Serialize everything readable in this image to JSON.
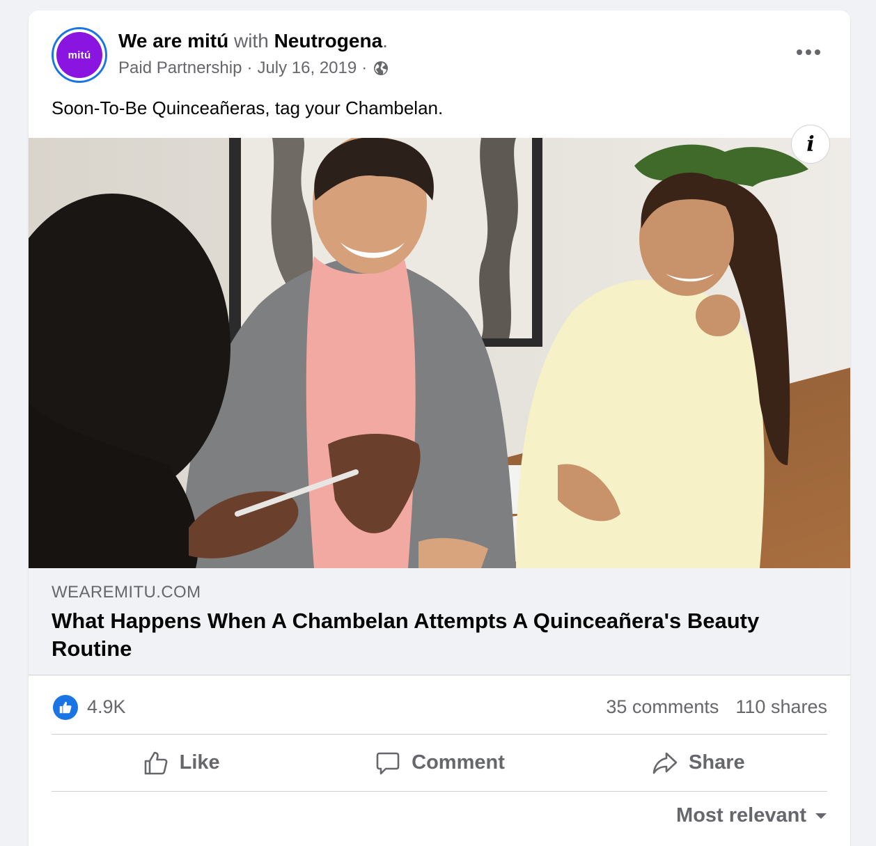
{
  "post": {
    "page_name": "We are mitú",
    "with_word": "with",
    "partner_name": "Neutrogena",
    "title_period": ".",
    "avatar_text": "mitú",
    "meta_label": "Paid Partnership",
    "meta_separator": "·",
    "date": "July 16, 2019",
    "caption": "Soon-To-Be Quinceañeras, tag your Chambelan.",
    "info_icon": "i"
  },
  "link_preview": {
    "domain": "WEAREMITU.COM",
    "headline": "What Happens When A Chambelan Attempts A Quinceañera's Beauty Routine"
  },
  "stats": {
    "reactions": "4.9K",
    "comments": "35 comments",
    "shares": "110 shares"
  },
  "actions": {
    "like": "Like",
    "comment": "Comment",
    "share": "Share"
  },
  "comments_sort": {
    "label": "Most relevant"
  },
  "colors": {
    "brand_blue": "#1b74e4",
    "avatar_purple": "#8a14e0",
    "secondary_text": "#65676b",
    "preview_bg": "#f0f2f5"
  },
  "icons": {
    "more": "more-horizontal-icon",
    "globe": "globe-icon",
    "info": "info-icon",
    "like_reaction": "thumbs-up-reaction-icon",
    "like_action": "thumbs-up-icon",
    "comment_action": "comment-bubble-icon",
    "share_action": "share-arrow-icon",
    "sort_caret": "caret-down-icon"
  }
}
